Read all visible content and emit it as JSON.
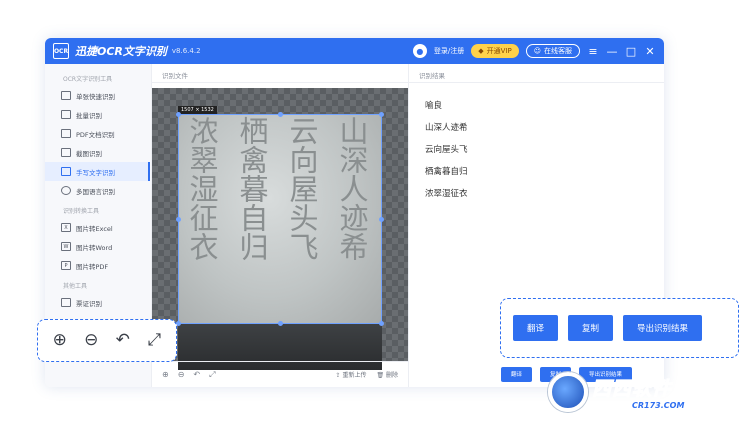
{
  "window": {
    "title": "迅捷OCR文字识别",
    "version": "v8.6.4.2",
    "logo": "OCR",
    "login": "登录/注册",
    "vip": "开通VIP",
    "service": "在线客服",
    "accent": "#2f6ff0"
  },
  "sidebar": {
    "group1": "OCR文字识别工具",
    "items1": [
      "单张快速识别",
      "批量识别",
      "PDF文档识别",
      "截图识别",
      "手写文字识别",
      "多国语言识别"
    ],
    "group2": "识别转换工具",
    "items2": [
      "图片转Excel",
      "图片转Word",
      "图片转PDF"
    ],
    "group3": "其他工具",
    "items3": [
      "票证识别"
    ]
  },
  "file_panel": {
    "title": "识别文件",
    "size": "1507 × 1532",
    "reupload": "重新上传",
    "delete": "删除"
  },
  "result_panel": {
    "title": "识别结果",
    "lines": [
      "喻良",
      "山深人迹希",
      "云向屋头飞",
      "栖禽暮自归",
      "浓翠湿征衣"
    ],
    "translate": "翻译",
    "copy": "复制",
    "export": "导出识别结果"
  },
  "callout_actions": {
    "translate": "翻译",
    "copy": "复制",
    "export": "导出识别结果"
  },
  "calligraphy": [
    "山深人迹希",
    "云向屋头飞",
    "栖禽暮自归",
    "浓翠湿征衣"
  ],
  "watermark": {
    "name_a": "西西",
    "name_b": "软件园",
    "url": "CR173.COM"
  }
}
